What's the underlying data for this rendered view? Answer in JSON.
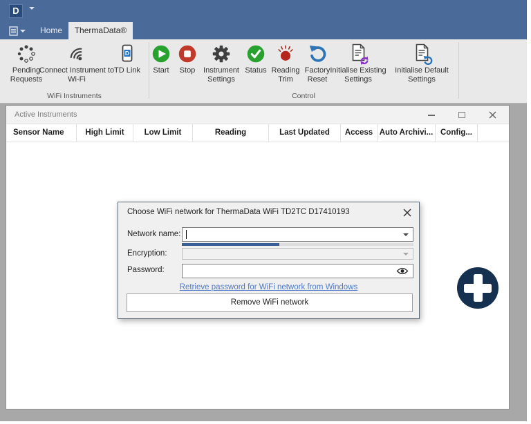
{
  "app": {
    "logo_letter": "D",
    "menu_tabs": [
      {
        "label": "Home"
      },
      {
        "label": "ThermaData®"
      }
    ]
  },
  "ribbon": {
    "groups": [
      {
        "label": "WiFi Instruments",
        "buttons": [
          {
            "label": "Pending Requests",
            "icon": "spinner-dots-icon"
          },
          {
            "label": "Connect Instrument to Wi-Fi",
            "icon": "wifi-icon"
          },
          {
            "label": "TD Link",
            "icon": "phone-icon"
          }
        ]
      },
      {
        "label": "Control",
        "buttons": [
          {
            "label": "Start",
            "icon": "play-icon"
          },
          {
            "label": "Stop",
            "icon": "stop-icon"
          },
          {
            "label": "Instrument Settings",
            "icon": "gear-icon"
          },
          {
            "label": "Status",
            "icon": "check-icon"
          },
          {
            "label": "Reading Trim",
            "icon": "trim-burst-icon"
          },
          {
            "label": "Factory Reset",
            "icon": "undo-arrow-icon"
          },
          {
            "label": "Initialise Existing Settings",
            "icon": "document-refresh-icon"
          },
          {
            "label": "Initialise Default Settings",
            "icon": "document-undo-icon"
          }
        ]
      }
    ]
  },
  "instruments_window": {
    "title": "Active Instruments",
    "columns": [
      "Sensor Name",
      "High Limit",
      "Low Limit",
      "Reading",
      "Last Updated",
      "Access",
      "Auto Archivi...",
      "Config..."
    ],
    "rows": []
  },
  "dialog": {
    "title": "Choose WiFi network for ThermaData WiFi TD2TC D17410193",
    "network_label": "Network name:",
    "network_value": "",
    "encryption_label": "Encryption:",
    "encryption_value": "",
    "password_label": "Password:",
    "password_value": "",
    "progress_percent": 42,
    "link_text": "Retrieve password for WiFi network from Windows",
    "remove_button_label": "Remove WiFi network"
  },
  "colors": {
    "titlebar_blue": "#4a6a9a",
    "logo_blue": "#2a4a7a",
    "ribbon_gray": "#e9e9e9",
    "client_gray": "#a8a8a8",
    "start_green": "#28a12f",
    "stop_red": "#c0392b",
    "status_green": "#28a12f",
    "trim_red": "#b5271d",
    "reset_blue": "#2e74b5",
    "refresh_purple": "#8b2fc9",
    "progress_blue": "#3a5f96",
    "link_blue": "#4d79c7",
    "add_button_navy": "#16314f"
  }
}
